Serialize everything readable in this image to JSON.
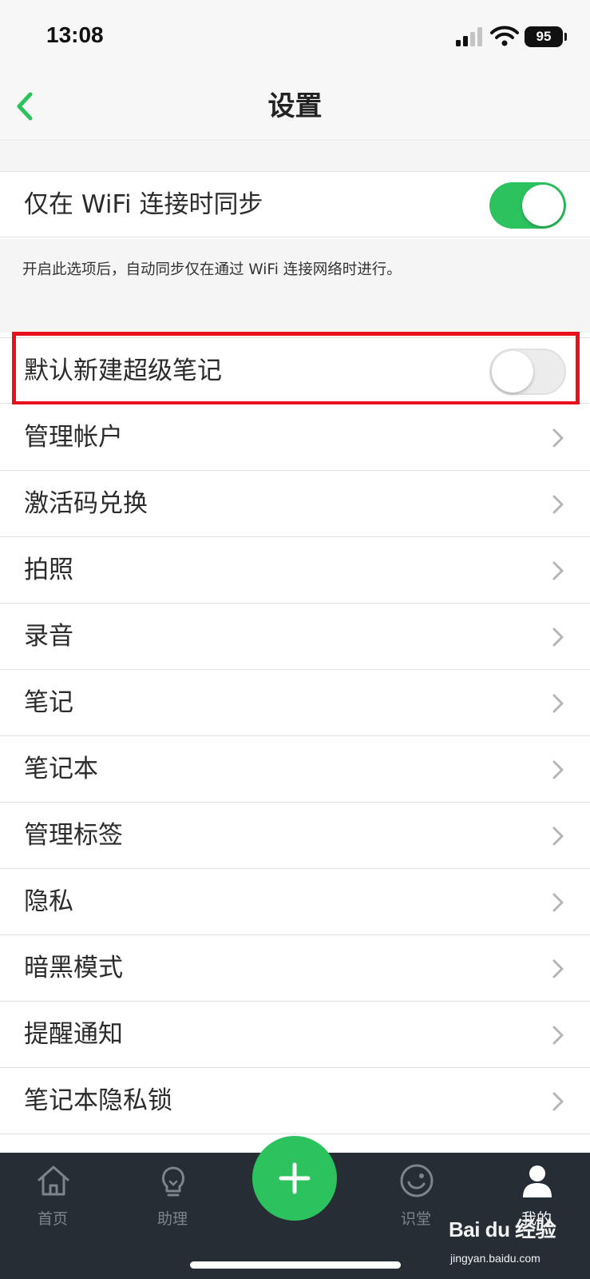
{
  "status_bar": {
    "time": "13:08",
    "battery": "95",
    "icons": [
      "signal-icon",
      "wifi-icon",
      "battery-icon"
    ]
  },
  "nav": {
    "title": "设置",
    "back_icon": "chevron-left-icon",
    "accent_color": "#2cc35f"
  },
  "settings": {
    "wifi_sync": {
      "label": "仅在 WiFi 连接时同步",
      "enabled": true
    },
    "wifi_sync_note": "开启此选项后，自动同步仅在通过 WiFi 连接网络时进行。",
    "default_super_note": {
      "label": "默认新建超级笔记",
      "enabled": false,
      "highlighted": true,
      "highlight_color": "#e8101b"
    },
    "items": [
      {
        "label": "管理帐户"
      },
      {
        "label": "激活码兑换"
      },
      {
        "label": "拍照"
      },
      {
        "label": "录音"
      },
      {
        "label": "笔记"
      },
      {
        "label": "笔记本"
      },
      {
        "label": "管理标签"
      },
      {
        "label": "隐私"
      },
      {
        "label": "暗黑模式"
      },
      {
        "label": "提醒通知"
      },
      {
        "label": "笔记本隐私锁"
      }
    ]
  },
  "tab_bar": {
    "background": "#262d35",
    "tabs": [
      {
        "label": "首页",
        "icon": "home-icon",
        "active": false
      },
      {
        "label": "助理",
        "icon": "lightbulb-icon",
        "active": false
      },
      {
        "label": "识堂",
        "icon": "smile-circle-icon",
        "active": false
      },
      {
        "label": "我的",
        "icon": "person-icon",
        "active": true
      }
    ],
    "fab_icon": "plus-icon"
  },
  "watermark": {
    "logo": "Bai du 经验",
    "url": "jingyan.baidu.com"
  }
}
